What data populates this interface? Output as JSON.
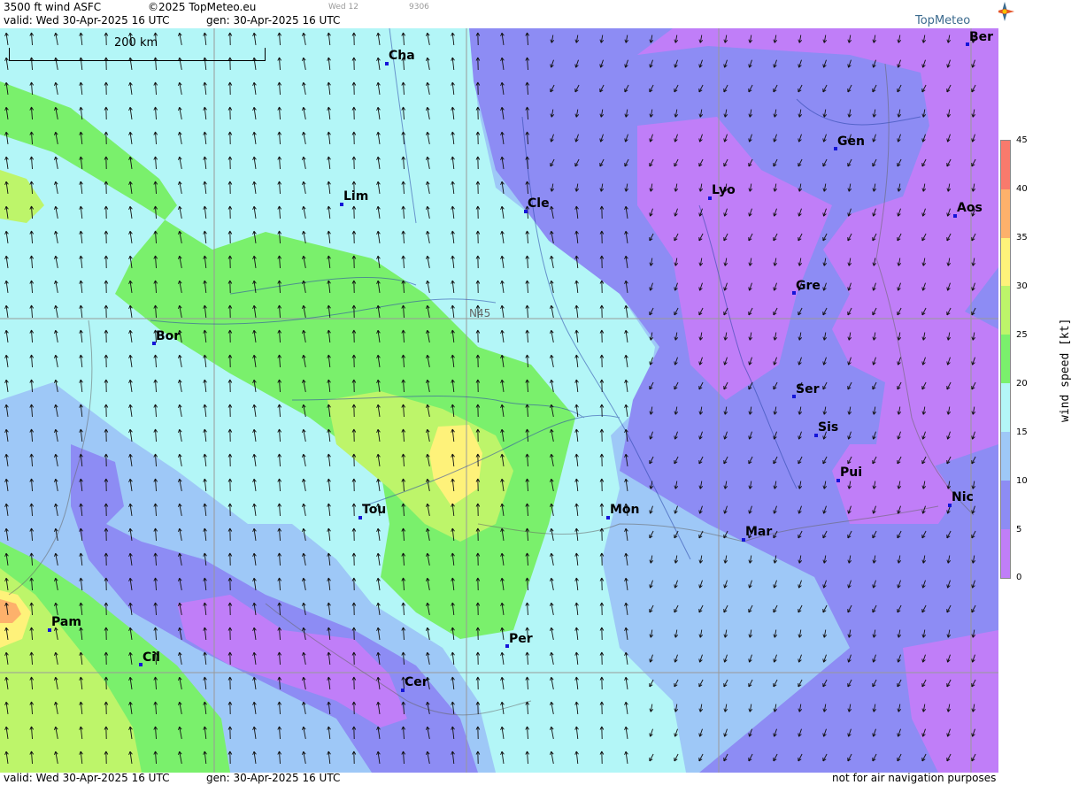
{
  "header": {
    "product": "3500 ft wind ASFC",
    "copyright": "©2025 TopMeteo.eu",
    "valid": "valid:  Wed  30-Apr-2025  16 UTC",
    "generated": "gen: 30-Apr-2025 16 UTC",
    "small_1": "Wed 12",
    "small_2": "9306",
    "brand": "TopMeteo"
  },
  "map": {
    "scale_label": "200 km",
    "grid_label": "N45",
    "cities": [
      {
        "name": "Cha"
      },
      {
        "name": "Ber"
      },
      {
        "name": "Gen"
      },
      {
        "name": "Lim"
      },
      {
        "name": "Cle"
      },
      {
        "name": "Lyo"
      },
      {
        "name": "Aos"
      },
      {
        "name": "Gre"
      },
      {
        "name": "Bor"
      },
      {
        "name": "Ser"
      },
      {
        "name": "Sis"
      },
      {
        "name": "Pui"
      },
      {
        "name": "Nic"
      },
      {
        "name": "Tou"
      },
      {
        "name": "Mon"
      },
      {
        "name": "Mar"
      },
      {
        "name": "Pam"
      },
      {
        "name": "Cil"
      },
      {
        "name": "Per"
      },
      {
        "name": "Cer"
      }
    ]
  },
  "legend": {
    "title": "wind speed [kt]",
    "ticks": [
      "45",
      "40",
      "35",
      "30",
      "25",
      "20",
      "15",
      "10",
      "5",
      "0"
    ],
    "colors": [
      "#f97a6c",
      "#fdb16b",
      "#fef27a",
      "#bdf56a",
      "#7af06c",
      "#b3f6f7",
      "#9ec8f7",
      "#8d8cf4",
      "#c07ef8"
    ]
  },
  "footer": {
    "valid": "valid:  Wed  30-Apr-2025  16 UTC",
    "generated": "gen: 30-Apr-2025 16 UTC",
    "disclaimer": "not for air navigation purposes"
  }
}
